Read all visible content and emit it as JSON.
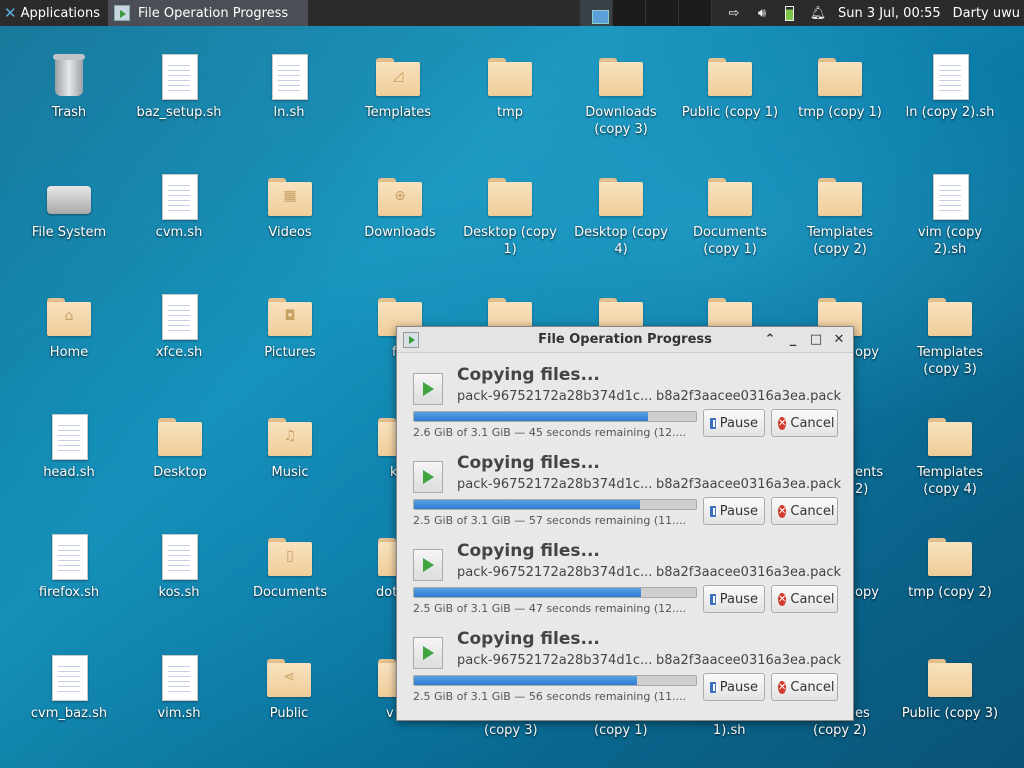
{
  "panel": {
    "apps_label": "Applications",
    "task_title": "File Operation Progress",
    "clock": "Sun  3 Jul, 00:55",
    "user": "Darty uwu"
  },
  "desktop": {
    "icons": [
      {
        "label": "Trash"
      },
      {
        "label": "baz_setup.sh"
      },
      {
        "label": "ln.sh"
      },
      {
        "label": "Templates"
      },
      {
        "label": "tmp"
      },
      {
        "label": "Downloads (copy 3)"
      },
      {
        "label": "Public (copy 1)"
      },
      {
        "label": "tmp (copy 1)"
      },
      {
        "label": "ln (copy 2).sh"
      },
      {
        "label": "File System"
      },
      {
        "label": "cvm.sh"
      },
      {
        "label": "Videos"
      },
      {
        "label": "Downloads"
      },
      {
        "label": "Desktop (copy 1)"
      },
      {
        "label": "Desktop (copy 4)"
      },
      {
        "label": "Documents (copy 1)"
      },
      {
        "label": "Templates (copy 2)"
      },
      {
        "label": "vim (copy 2).sh"
      },
      {
        "label": "Home"
      },
      {
        "label": "xfce.sh"
      },
      {
        "label": "Pictures"
      },
      {
        "label": "Templates (copy 3)"
      },
      {
        "label": "head.sh"
      },
      {
        "label": "Desktop"
      },
      {
        "label": "Music"
      },
      {
        "label": "Templates (copy 4)"
      },
      {
        "label": "firefox.sh"
      },
      {
        "label": "kos.sh"
      },
      {
        "label": "Documents"
      },
      {
        "label": "tmp (copy 2)"
      },
      {
        "label": "cvm_baz.sh"
      },
      {
        "label": "vim.sh"
      },
      {
        "label": "Public"
      },
      {
        "label": "Public (copy 3)"
      }
    ],
    "partials": [
      "f",
      "opy",
      "k",
      "ents",
      "2)",
      "dot",
      "opy",
      "v",
      "es",
      "(copy 3)",
      "(copy 1)",
      "1).sh",
      "(copy 2)"
    ]
  },
  "dialog": {
    "title": "File Operation Progress",
    "pause_label": "Pause",
    "cancel_label": "Cancel",
    "operations": [
      {
        "heading": "Copying files...",
        "source": "pack-96752172a28b374d1c...",
        "dest": "b8a2f3aacee0316a3ea.pack",
        "status": "2.6 GiB of 3.1 GiB — 45 seconds remaining (12....",
        "progress": 0.83
      },
      {
        "heading": "Copying files...",
        "source": "pack-96752172a28b374d1c...",
        "dest": "b8a2f3aacee0316a3ea.pack",
        "status": "2.5 GiB of 3.1 GiB — 57 seconds remaining (11....",
        "progress": 0.8
      },
      {
        "heading": "Copying files...",
        "source": "pack-96752172a28b374d1c...",
        "dest": "b8a2f3aacee0316a3ea.pack",
        "status": "2.5 GiB of 3.1 GiB — 47 seconds remaining (12....",
        "progress": 0.805
      },
      {
        "heading": "Copying files...",
        "source": "pack-96752172a28b374d1c...",
        "dest": "b8a2f3aacee0316a3ea.pack",
        "status": "2.5 GiB of 3.1 GiB — 56 seconds remaining (11....",
        "progress": 0.79
      }
    ]
  }
}
